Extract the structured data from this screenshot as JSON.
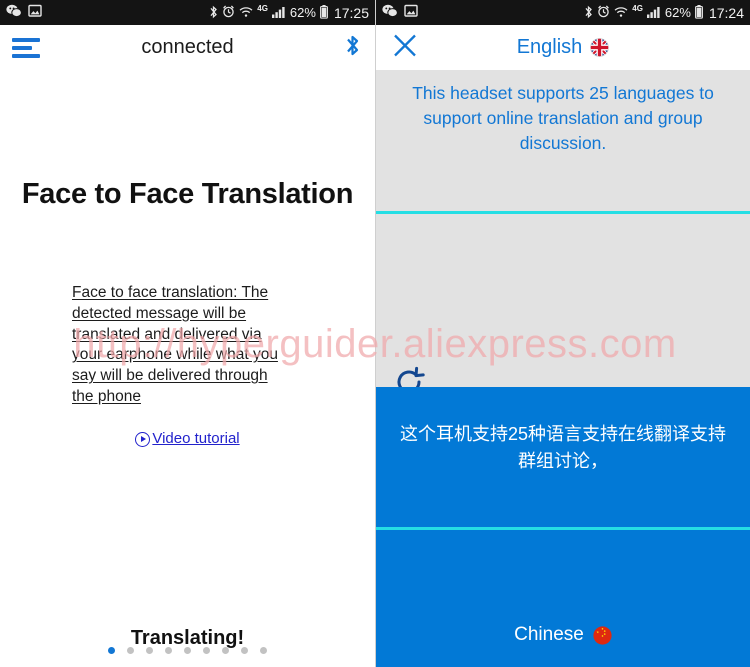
{
  "colors": {
    "accent_blue": "#1277d4",
    "panel_blue": "#0279d6",
    "divider_cyan": "#25dee4",
    "panel_gray": "#e2e2e2",
    "watermark_pink": "#f0a9ab",
    "link_blue": "#2222cc"
  },
  "watermark": {
    "text": "http://hyperguider.aliexpress.com"
  },
  "left_screen": {
    "status_bar": {
      "left_icons": [
        "wechat-icon",
        "gallery-icon"
      ],
      "right_icons": [
        "bluetooth-icon",
        "alarm-icon",
        "wifi-icon"
      ],
      "network": "4G",
      "signal": "signal-bars-icon",
      "battery_percent": "62%",
      "battery_icon": "battery-icon",
      "time": "17:25"
    },
    "app_bar": {
      "menu_icon": "hamburger-menu-icon",
      "title": "connected",
      "bluetooth_icon": "bluetooth-icon"
    },
    "title": "Face to Face Translation",
    "description": "Face to face translation: The detected message will be translated and delivered via your earphone while what you say will be delivered through the phone",
    "video_link": {
      "icon": "play-circle-icon",
      "label": "Video tutorial"
    },
    "status_text": "Translating!",
    "pagination": {
      "total": 9,
      "active_index": 0
    }
  },
  "right_screen": {
    "status_bar": {
      "left_icons": [
        "wechat-icon",
        "gallery-icon"
      ],
      "right_icons": [
        "bluetooth-icon",
        "alarm-icon",
        "wifi-icon"
      ],
      "network": "4G",
      "signal": "signal-bars-icon",
      "battery_percent": "62%",
      "battery_icon": "battery-icon",
      "time": "17:24"
    },
    "app_bar": {
      "close_icon": "close-x-icon",
      "language": "English",
      "flag_icon": "uk-flag-icon"
    },
    "source_text": "This headset supports 25 languages to support online translation and group discussion.",
    "refresh_icon": "refresh-rotate-icon",
    "translated_text": "这个耳机支持25种语言支持在线翻译支持群组讨论，",
    "target_language": "Chinese",
    "target_flag_icon": "china-flag-icon"
  }
}
